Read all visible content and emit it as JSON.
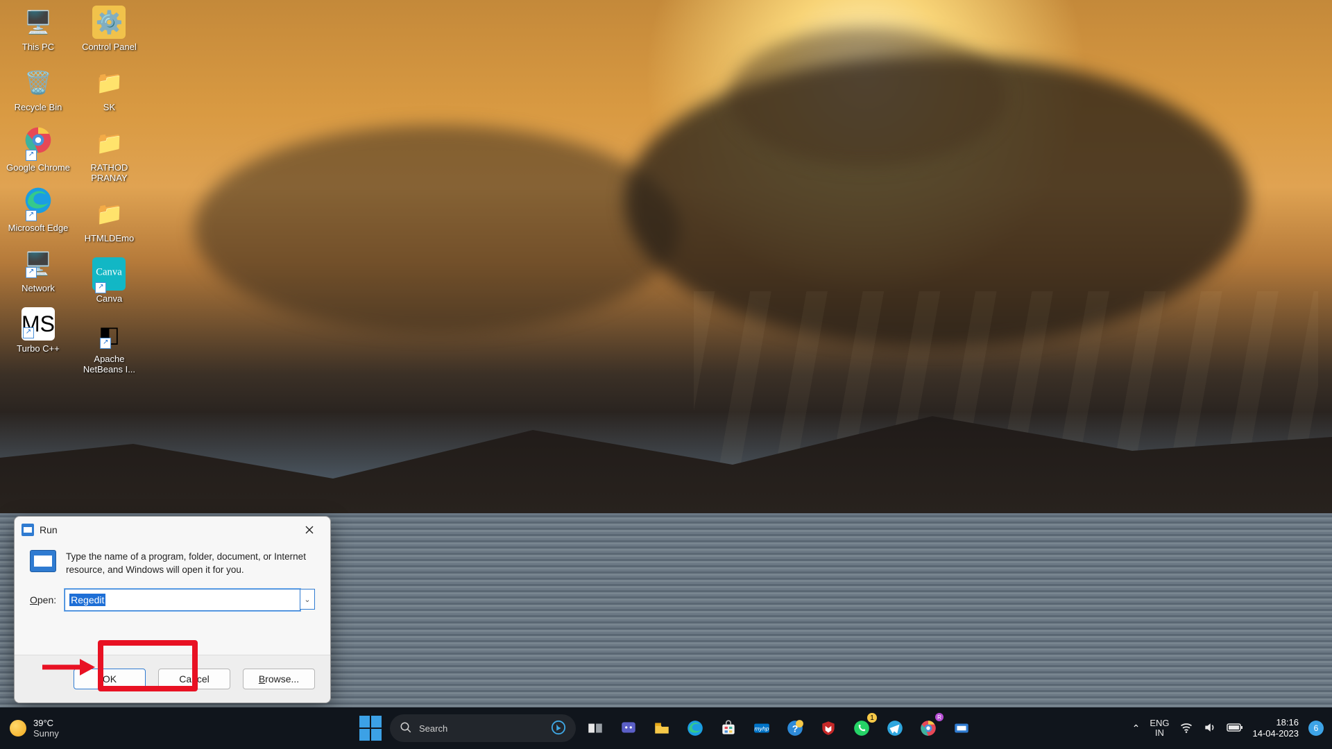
{
  "desktop_icons": {
    "col1": [
      {
        "label": "This PC",
        "glyph": "🖥️",
        "bg": ""
      },
      {
        "label": "Recycle Bin",
        "glyph": "🗑️",
        "bg": ""
      },
      {
        "label": "Google Chrome",
        "glyph": "●",
        "bg": "",
        "shortcut": true,
        "chrome": true
      },
      {
        "label": "Microsoft Edge",
        "glyph": "🌐",
        "bg": "",
        "shortcut": true,
        "edge": true
      },
      {
        "label": "Network",
        "glyph": "🖥️",
        "bg": "",
        "shortcut": true
      },
      {
        "label": "Turbo C++",
        "glyph": "MS",
        "bg": "#fff",
        "shortcut": true
      }
    ],
    "col2": [
      {
        "label": "Control Panel",
        "glyph": "⚙️",
        "bg": "#f1c24b"
      },
      {
        "label": "SK",
        "glyph": "📁",
        "bg": ""
      },
      {
        "label": "RATHOD PRANAY",
        "glyph": "📁",
        "bg": ""
      },
      {
        "label": "HTMLDEmo",
        "glyph": "📁",
        "bg": ""
      },
      {
        "label": "Canva",
        "glyph": "C",
        "bg": "#12b7c5",
        "shortcut": true,
        "canva": true
      },
      {
        "label": "Apache NetBeans I...",
        "glyph": "◧",
        "bg": "",
        "shortcut": true
      }
    ]
  },
  "run_dialog": {
    "title": "Run",
    "description": "Type the name of a program, folder, document, or Internet resource, and Windows will open it for you.",
    "open_label": "Open:",
    "open_hotkey": "O",
    "input_value": "Regedit",
    "ok": "OK",
    "cancel": "Cancel",
    "browse": "Browse...",
    "browse_hotkey": "B"
  },
  "taskbar": {
    "weather_temp": "39°C",
    "weather_desc": "Sunny",
    "search_placeholder": "Search",
    "lang_top": "ENG",
    "lang_bottom": "IN",
    "time": "18:16",
    "date": "14-04-2023",
    "notif_count": "6"
  }
}
